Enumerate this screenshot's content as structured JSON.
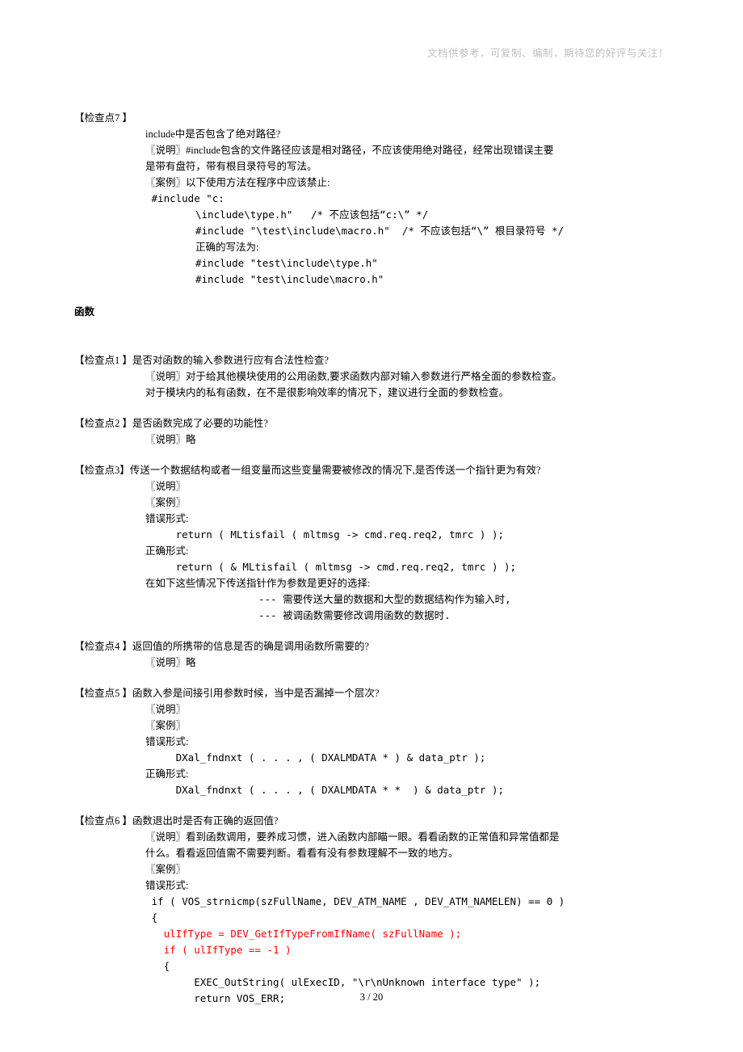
{
  "watermark": "文档供参考，可复制、编制，期待您的好评与关注！",
  "cp7": {
    "label": "【检查点7 】",
    "l1": "include中是否包含了绝对路径?",
    "l2": "〖说明〗#include包含的文件路径应该是相对路径，不应该使用绝对路径，经常出现错误主要",
    "l3": "是带有盘符，带有根目录符号的写法。",
    "l4": "〖案例〗以下使用方法在程序中应该禁止:",
    "l5": " #include \"c:",
    "l6": "\\include\\type.h\"   /* 不应该包括“c:\\” */",
    "l7": "#include \"\\test\\include\\macro.h\"  /* 不应该包括“\\” 根目录符号 */",
    "l8": "正确的写法为:",
    "l9": "#include \"test\\include\\type.h\"",
    "l10": "#include \"test\\include\\macro.h\""
  },
  "section_func": "函数",
  "cp1": {
    "label": "【检查点1 】",
    "title": "是否对函数的输入参数进行应有合法性检查?",
    "l1": "〖说明〗对于给其他模块使用的公用函数,要求函数内部对输入参数进行严格全面的参数检查。",
    "l2": "对于模块内的私有函数，在不是很影响效率的情况下，建议进行全面的参数检查。"
  },
  "cp2": {
    "label": "【检查点2 】",
    "title": "是否函数完成了必要的功能性?",
    "l1": "〖说明〗略"
  },
  "cp3": {
    "label": "【检查点3】",
    "title": "传送一个数据结构或者一组变量而这些变量需要被修改的情况下,是否传送一个指针更为有效?",
    "l1": "〖说明〗",
    "l2": "〖案例〗",
    "l3": " 错误形式:",
    "l4": "     return ( MLtisfail ( mltmsg -> cmd.req.req2, tmrc ) );",
    "l5": " 正确形式:",
    "l6": "     return ( & MLtisfail ( mltmsg -> cmd.req.req2, tmrc ) );",
    "l7": " 在如下这些情况下传送指针作为参数是更好的选择:",
    "l8": "--- 需要传送大量的数据和大型的数据结构作为输入时,",
    "l9": "--- 被调函数需要修改调用函数的数据时."
  },
  "cp4": {
    "label": "【检查点4 】",
    "title": "返回值的所携带的信息是否的确是调用函数所需要的?",
    "l1": "〖说明〗略"
  },
  "cp5": {
    "label": "【检查点5 】",
    "title": "函数入参是间接引用参数时候，当中是否漏掉一个层次?",
    "l1": "〖说明〗",
    "l2": "〖案例〗",
    "l3": " 错误形式:",
    "l4": "     DXal_fndnxt ( . . . , ( DXALMDATA * ) & data_ptr );",
    "l5": " 正确形式:",
    "l6": "     DXal_fndnxt ( . . . , ( DXALMDATA * *  ) & data_ptr );"
  },
  "cp6": {
    "label": "【检查点6 】",
    "title": "函数退出时是否有正确的返回值?",
    "l1": "〖说明〗看到函数调用，要养成习惯，进入函数内部瞄一眼。看看函数的正常值和异常值都是",
    "l2": "什么。看看返回值需不需要判断。看看有没有参数理解不一致的地方。",
    "l3": "〖案例〗",
    "l4": " 错误形式:",
    "c1": " if ( VOS_strnicmp(szFullName, DEV_ATM_NAME , DEV_ATM_NAMELEN) == 0 )",
    "c2": " {",
    "c3": "   ulIfType = DEV_GetIfTypeFromIfName( szFullName );",
    "c4": "   if ( ulIfType == -1 )",
    "c5": "   {",
    "c6": "        EXEC_OutString( ulExecID, \"\\r\\nUnknown interface type\" );",
    "c7": "        return VOS_ERR;"
  },
  "page_number": "3 / 20"
}
